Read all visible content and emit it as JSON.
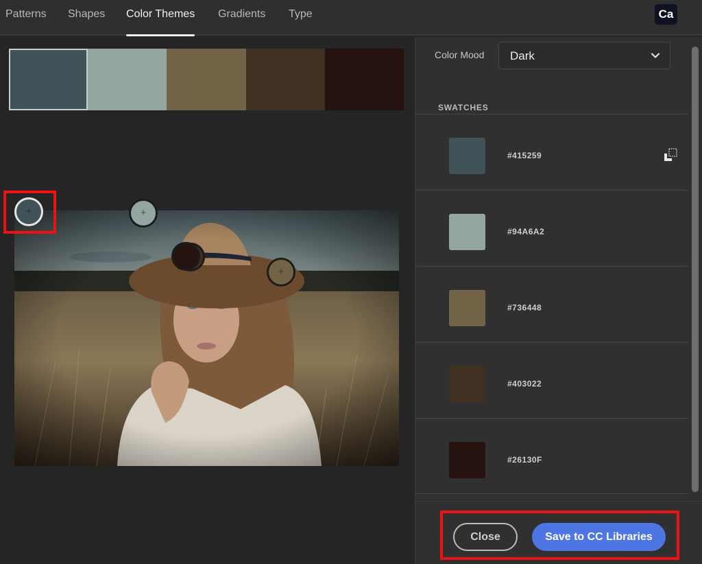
{
  "nav": {
    "tabs": [
      {
        "label": "Patterns",
        "active": false
      },
      {
        "label": "Shapes",
        "active": false
      },
      {
        "label": "Color Themes",
        "active": true
      },
      {
        "label": "Gradients",
        "active": false
      },
      {
        "label": "Type",
        "active": false
      }
    ],
    "app_badge": "Ca"
  },
  "palette": {
    "colors": [
      "#415259",
      "#94A6A2",
      "#736448",
      "#403022",
      "#26130F"
    ],
    "selected_index": 0
  },
  "image": {
    "description": "Portrait of a woman in a brown hat in a wheat field",
    "pickers": [
      {
        "color": "#415259",
        "selected": true
      },
      {
        "color": "#94A6A2",
        "selected": false
      },
      {
        "color": "#26130F",
        "selected": false
      },
      {
        "color": "#403022",
        "selected": false
      },
      {
        "color": "#736448",
        "selected": false
      }
    ]
  },
  "panel": {
    "mood_label": "Color Mood",
    "mood_value": "Dark",
    "swatches_header": "SWATCHES",
    "swatches": [
      {
        "hex": "#415259",
        "color": "#415259"
      },
      {
        "hex": "#94A6A2",
        "color": "#94A6A2"
      },
      {
        "hex": "#736448",
        "color": "#736448"
      },
      {
        "hex": "#403022",
        "color": "#403022"
      },
      {
        "hex": "#26130F",
        "color": "#26130F"
      }
    ],
    "copy_icon": "copy-icon"
  },
  "footer": {
    "close_label": "Close",
    "save_label": "Save to CC Libraries"
  },
  "highlight_color": "#EE1111"
}
